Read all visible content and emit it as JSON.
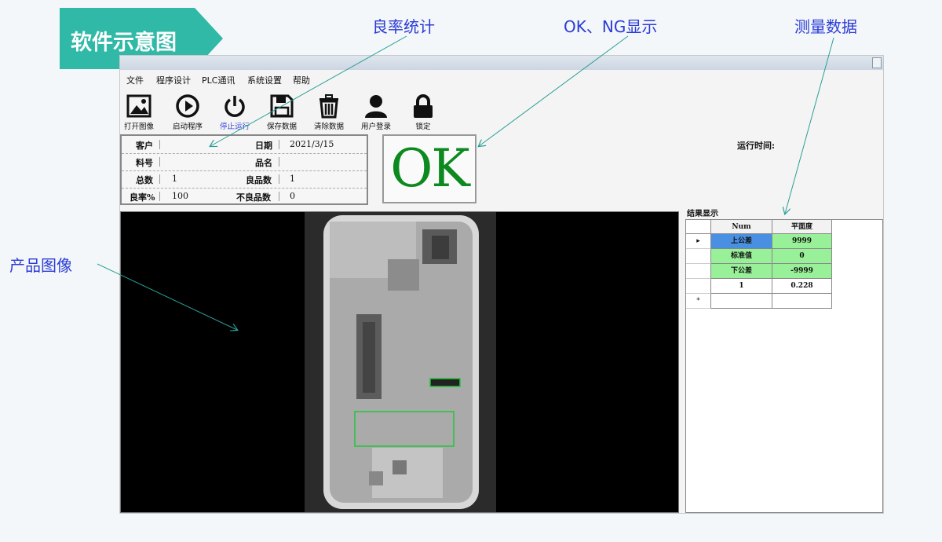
{
  "slide": {
    "title": "软件示意图",
    "callouts": {
      "yield": "良率统计",
      "ok_ng": "OK、NG显示",
      "measure": "测量数据",
      "product": "产品图像"
    }
  },
  "menu": [
    "文件",
    "程序设计",
    "PLC通讯",
    "系统设置",
    "帮助"
  ],
  "toolbar": [
    {
      "label": "打开图像",
      "icon": "image-icon"
    },
    {
      "label": "启动程序",
      "icon": "play-icon"
    },
    {
      "label": "停止运行",
      "icon": "power-icon"
    },
    {
      "label": "保存数据",
      "icon": "save-icon"
    },
    {
      "label": "清除数据",
      "icon": "trash-icon"
    },
    {
      "label": "用户登录",
      "icon": "user-icon"
    },
    {
      "label": "锁定",
      "icon": "lock-icon"
    }
  ],
  "info": {
    "customer_label": "客户",
    "customer": "",
    "date_label": "日期",
    "date": "2021/3/15",
    "part_label": "料号",
    "part": "",
    "product_label": "品名",
    "product": "",
    "total_label": "总数",
    "total": "1",
    "good_label": "良品数",
    "good": "1",
    "yield_label": "良率%",
    "yield": "100",
    "bad_label": "不良品数",
    "bad": "0"
  },
  "status": "OK",
  "runtime_label": "运行时间:",
  "results": {
    "label": "结果显示",
    "headers": [
      "Num",
      "平面度"
    ],
    "rows": [
      {
        "num": "上公差",
        "val": "9999",
        "numBg": "#4a90e2",
        "valBg": "#98f098"
      },
      {
        "num": "标准值",
        "val": "0",
        "numBg": "#98f098",
        "valBg": "#98f098"
      },
      {
        "num": "下公差",
        "val": "-9999",
        "numBg": "#98f098",
        "valBg": "#98f098"
      },
      {
        "num": "1",
        "val": "0.228",
        "numBg": "#ffffff",
        "valBg": "#ffffff"
      }
    ],
    "current_marker": "▸",
    "new_marker": "*"
  },
  "colors": {
    "accent": "#2fb9a6",
    "ok": "#0c8a20",
    "callout": "#2b3bd6"
  }
}
